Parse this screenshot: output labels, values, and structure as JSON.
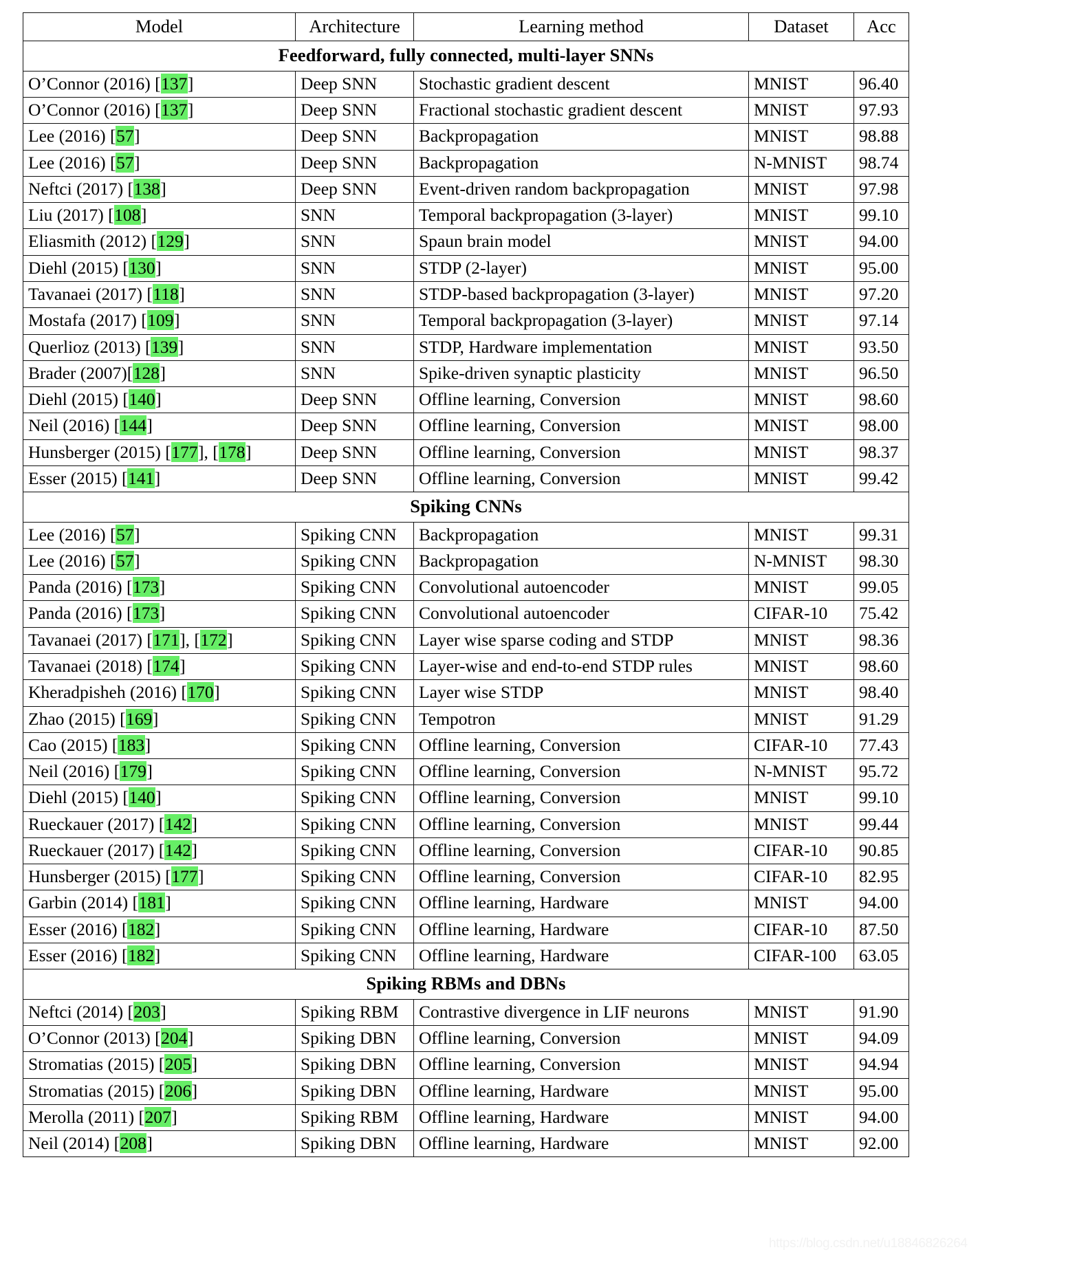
{
  "table": {
    "columns": [
      "Model",
      "Architecture",
      "Learning method",
      "Dataset",
      "Acc"
    ],
    "sections": [
      {
        "title": "Feedforward, fully connected, multi-layer SNNs",
        "rows": [
          {
            "model_name": "O’Connor (2016) [",
            "model_cite": "137",
            "model_tail": "]",
            "architecture": "Deep SNN",
            "method": "Stochastic gradient descent",
            "dataset": "MNIST",
            "acc": "96.40"
          },
          {
            "model_name": "O’Connor (2016) [",
            "model_cite": "137",
            "model_tail": "]",
            "architecture": "Deep SNN",
            "method": "Fractional stochastic gradient descent",
            "dataset": "MNIST",
            "acc": "97.93"
          },
          {
            "model_name": "Lee (2016) [",
            "model_cite": "57",
            "model_tail": "]",
            "architecture": "Deep SNN",
            "method": "Backpropagation",
            "dataset": "MNIST",
            "acc": "98.88"
          },
          {
            "model_name": "Lee (2016) [",
            "model_cite": "57",
            "model_tail": "]",
            "architecture": "Deep SNN",
            "method": "Backpropagation",
            "dataset": "N-MNIST",
            "acc": "98.74"
          },
          {
            "model_name": "Neftci (2017) [",
            "model_cite": "138",
            "model_tail": "]",
            "architecture": "Deep SNN",
            "method": "Event-driven random backpropagation",
            "dataset": "MNIST",
            "acc": "97.98"
          },
          {
            "model_name": "Liu (2017) [",
            "model_cite": "108",
            "model_tail": "]",
            "architecture": "SNN",
            "method": "Temporal backpropagation (3-layer)",
            "dataset": "MNIST",
            "acc": "99.10"
          },
          {
            "model_name": "Eliasmith (2012) [",
            "model_cite": "129",
            "model_tail": "]",
            "architecture": "SNN",
            "method": "Spaun brain model",
            "dataset": "MNIST",
            "acc": "94.00"
          },
          {
            "model_name": "Diehl (2015) [",
            "model_cite": "130",
            "model_tail": "]",
            "architecture": "SNN",
            "method": "STDP (2-layer)",
            "dataset": "MNIST",
            "acc": "95.00"
          },
          {
            "model_name": "Tavanaei (2017) [",
            "model_cite": "118",
            "model_tail": "]",
            "architecture": "SNN",
            "method": "STDP-based backpropagation (3-layer)",
            "dataset": "MNIST",
            "acc": "97.20"
          },
          {
            "model_name": "Mostafa (2017) [",
            "model_cite": "109",
            "model_tail": "]",
            "architecture": "SNN",
            "method": "Temporal backpropagation (3-layer)",
            "dataset": "MNIST",
            "acc": "97.14"
          },
          {
            "model_name": "Querlioz (2013) [",
            "model_cite": "139",
            "model_tail": "]",
            "architecture": "SNN",
            "method": "STDP, Hardware implementation",
            "dataset": "MNIST",
            "acc": "93.50"
          },
          {
            "model_name": "Brader (2007)[",
            "model_cite": "128",
            "model_tail": "]",
            "architecture": "SNN",
            "method": "Spike-driven synaptic plasticity",
            "dataset": "MNIST",
            "acc": "96.50"
          },
          {
            "model_name": "Diehl (2015) [",
            "model_cite": "140",
            "model_tail": "]",
            "architecture": "Deep SNN",
            "method": "Offline learning, Conversion",
            "dataset": "MNIST",
            "acc": "98.60"
          },
          {
            "model_name": "Neil (2016) [",
            "model_cite": "144",
            "model_tail": "]",
            "architecture": "Deep SNN",
            "method": "Offline learning, Conversion",
            "dataset": "MNIST",
            "acc": "98.00"
          },
          {
            "model_name": "Hunsberger (2015) [",
            "model_cite": "177",
            "model_tail": "], [",
            "model_cite2": "178",
            "model_tail2": "]",
            "architecture": "Deep SNN",
            "method": "Offline learning, Conversion",
            "dataset": "MNIST",
            "acc": "98.37"
          },
          {
            "model_name": "Esser (2015) [",
            "model_cite": "141",
            "model_tail": "]",
            "architecture": "Deep SNN",
            "method": "Offline learning, Conversion",
            "dataset": "MNIST",
            "acc": "99.42"
          }
        ]
      },
      {
        "title": "Spiking CNNs",
        "rows": [
          {
            "model_name": "Lee (2016) [",
            "model_cite": "57",
            "model_tail": "]",
            "architecture": "Spiking CNN",
            "method": "Backpropagation",
            "dataset": "MNIST",
            "acc": "99.31"
          },
          {
            "model_name": "Lee (2016) [",
            "model_cite": "57",
            "model_tail": "]",
            "architecture": "Spiking CNN",
            "method": "Backpropagation",
            "dataset": "N-MNIST",
            "acc": "98.30"
          },
          {
            "model_name": "Panda (2016) [",
            "model_cite": "173",
            "model_tail": "]",
            "architecture": "Spiking CNN",
            "method": "Convolutional autoencoder",
            "dataset": "MNIST",
            "acc": "99.05"
          },
          {
            "model_name": "Panda (2016) [",
            "model_cite": "173",
            "model_tail": "]",
            "architecture": "Spiking CNN",
            "method": "Convolutional autoencoder",
            "dataset": "CIFAR-10",
            "acc": "75.42"
          },
          {
            "model_name": "Tavanaei (2017) [",
            "model_cite": "171",
            "model_tail": "], [",
            "model_cite2": "172",
            "model_tail2": "]",
            "architecture": "Spiking CNN",
            "method": "Layer wise sparse coding and STDP",
            "dataset": "MNIST",
            "acc": "98.36"
          },
          {
            "model_name": "Tavanaei (2018) [",
            "model_cite": "174",
            "model_tail": "]",
            "architecture": "Spiking CNN",
            "method": "Layer-wise and end-to-end STDP rules",
            "dataset": "MNIST",
            "acc": "98.60"
          },
          {
            "model_name": "Kheradpisheh (2016) [",
            "model_cite": "170",
            "model_tail": "]",
            "architecture": "Spiking CNN",
            "method": "Layer wise STDP",
            "dataset": "MNIST",
            "acc": "98.40"
          },
          {
            "model_name": "Zhao (2015) [",
            "model_cite": "169",
            "model_tail": "]",
            "architecture": "Spiking CNN",
            "method": "Tempotron",
            "dataset": "MNIST",
            "acc": "91.29"
          },
          {
            "model_name": "Cao (2015) [",
            "model_cite": "183",
            "model_tail": "]",
            "architecture": "Spiking CNN",
            "method": "Offline learning, Conversion",
            "dataset": "CIFAR-10",
            "acc": "77.43"
          },
          {
            "model_name": "Neil (2016) [",
            "model_cite": "179",
            "model_tail": "]",
            "architecture": "Spiking CNN",
            "method": "Offline learning, Conversion",
            "dataset": "N-MNIST",
            "acc": "95.72"
          },
          {
            "model_name": "Diehl (2015) [",
            "model_cite": "140",
            "model_tail": "]",
            "architecture": "Spiking CNN",
            "method": "Offline learning, Conversion",
            "dataset": "MNIST",
            "acc": "99.10"
          },
          {
            "model_name": "Rueckauer (2017) [",
            "model_cite": "142",
            "model_tail": "]",
            "architecture": "Spiking CNN",
            "method": "Offline learning, Conversion",
            "dataset": "MNIST",
            "acc": "99.44"
          },
          {
            "model_name": "Rueckauer (2017) [",
            "model_cite": "142",
            "model_tail": "]",
            "architecture": "Spiking CNN",
            "method": "Offline learning, Conversion",
            "dataset": "CIFAR-10",
            "acc": "90.85"
          },
          {
            "model_name": "Hunsberger (2015) [",
            "model_cite": "177",
            "model_tail": "]",
            "architecture": "Spiking CNN",
            "method": "Offline learning, Conversion",
            "dataset": "CIFAR-10",
            "acc": "82.95"
          },
          {
            "model_name": "Garbin (2014) [",
            "model_cite": "181",
            "model_tail": "]",
            "architecture": "Spiking CNN",
            "method": "Offline learning, Hardware",
            "dataset": "MNIST",
            "acc": "94.00"
          },
          {
            "model_name": "Esser (2016) [",
            "model_cite": "182",
            "model_tail": "]",
            "architecture": "Spiking CNN",
            "method": "Offline learning, Hardware",
            "dataset": "CIFAR-10",
            "acc": "87.50"
          },
          {
            "model_name": "Esser (2016) [",
            "model_cite": "182",
            "model_tail": "]",
            "architecture": "Spiking CNN",
            "method": "Offline learning, Hardware",
            "dataset": "CIFAR-100",
            "acc": "63.05"
          }
        ]
      },
      {
        "title": "Spiking RBMs and DBNs",
        "rows": [
          {
            "model_name": "Neftci (2014) [",
            "model_cite": "203",
            "model_tail": "]",
            "architecture": "Spiking RBM",
            "method": "Contrastive divergence in LIF neurons",
            "dataset": "MNIST",
            "acc": "91.90"
          },
          {
            "model_name": "O’Connor (2013) [",
            "model_cite": "204",
            "model_tail": "]",
            "architecture": "Spiking DBN",
            "method": "Offline learning, Conversion",
            "dataset": "MNIST",
            "acc": "94.09"
          },
          {
            "model_name": "Stromatias (2015) [",
            "model_cite": "205",
            "model_tail": "]",
            "architecture": "Spiking DBN",
            "method": "Offline learning, Conversion",
            "dataset": "MNIST",
            "acc": "94.94"
          },
          {
            "model_name": "Stromatias (2015) [",
            "model_cite": "206",
            "model_tail": "]",
            "architecture": "Spiking DBN",
            "method": "Offline learning, Hardware",
            "dataset": "MNIST",
            "acc": "95.00"
          },
          {
            "model_name": "Merolla (2011) [",
            "model_cite": "207",
            "model_tail": "]",
            "architecture": "Spiking RBM",
            "method": "Offline learning, Hardware",
            "dataset": "MNIST",
            "acc": "94.00"
          },
          {
            "model_name": "Neil (2014) [",
            "model_cite": "208",
            "model_tail": "]",
            "architecture": "Spiking DBN",
            "method": "Offline learning, Hardware",
            "dataset": "MNIST",
            "acc": "92.00"
          }
        ]
      }
    ]
  },
  "watermark": "https://blog.csdn.net/u18846826264",
  "colors": {
    "citation_highlight": "#66ee66",
    "border": "#111111",
    "text": "#000000"
  }
}
